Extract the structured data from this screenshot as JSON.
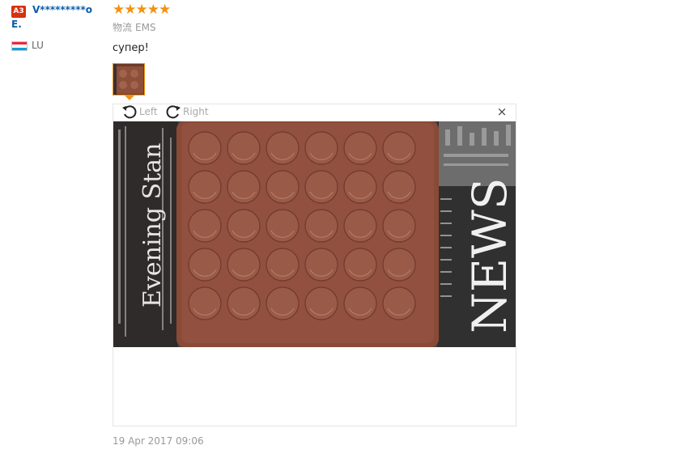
{
  "user": {
    "level": "A3",
    "name_line1": "V*********o",
    "name_line2": "E.",
    "country": "LU",
    "flag_colors": [
      "#ed2939",
      "#ffffff",
      "#00a1de"
    ]
  },
  "review": {
    "rating": 5,
    "stars_text": "★★★★★",
    "logistics_label": "物流",
    "logistics_value": "EMS",
    "text": "супер!",
    "date": "19 Apr 2017 09:06"
  },
  "viewer": {
    "rotate_left_label": "Left",
    "rotate_right_label": "Right",
    "close_icon": "×",
    "photo_texts": {
      "newspaper_left": "Evening Stan",
      "newspaper_right": "NEWS"
    }
  },
  "colors": {
    "accent": "#f29310",
    "link": "#0a5dab",
    "badge": "#d9300f",
    "mat": "#8a4a36"
  }
}
